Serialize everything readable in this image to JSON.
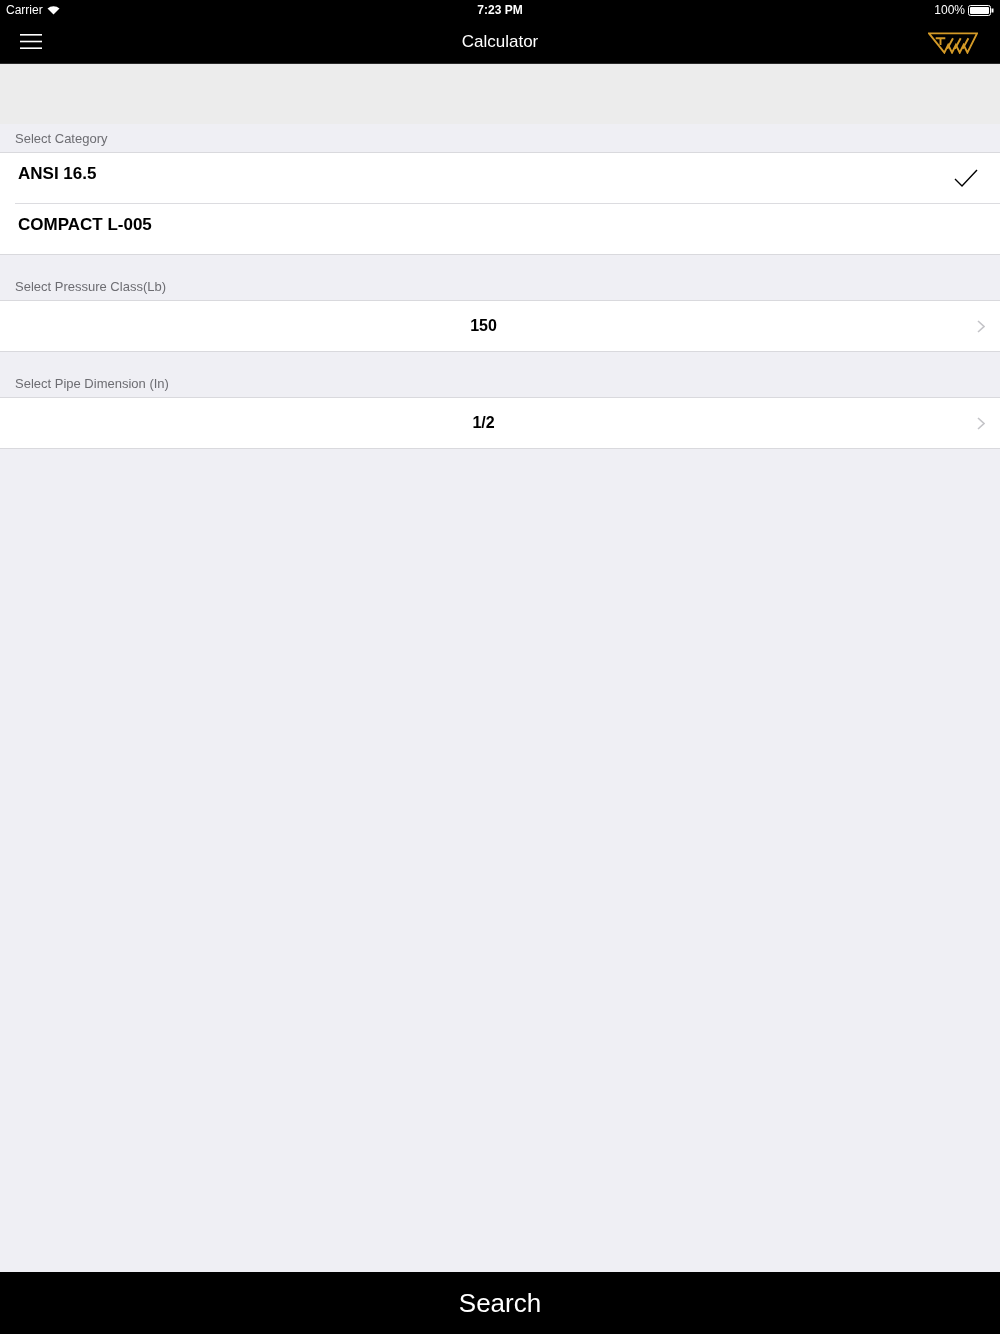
{
  "status_bar": {
    "carrier": "Carrier",
    "time": "7:23 PM",
    "battery": "100%"
  },
  "nav_bar": {
    "title": "Calculator"
  },
  "category": {
    "header": "Select Category",
    "items": [
      {
        "label": "ANSI 16.5",
        "selected": true
      },
      {
        "label": "COMPACT L-005",
        "selected": false
      }
    ]
  },
  "pressure_class": {
    "header": "Select Pressure Class(Lb)",
    "value": "150"
  },
  "pipe_dimension": {
    "header": "Select Pipe Dimension (In)",
    "value": "1/2"
  },
  "search_button": {
    "label": "Search"
  }
}
